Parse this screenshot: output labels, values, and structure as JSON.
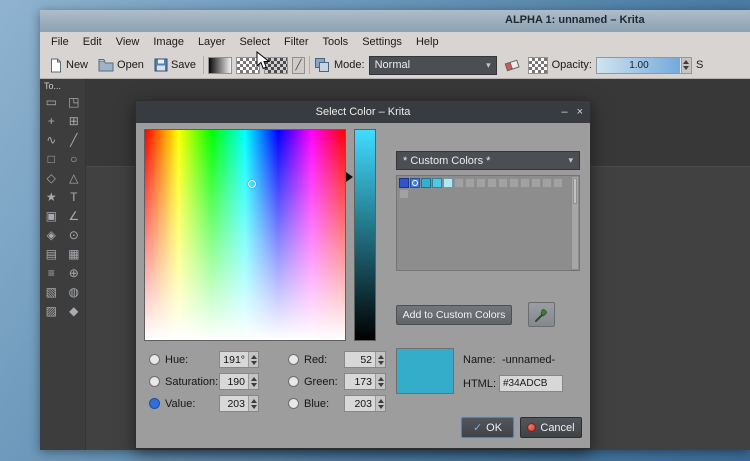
{
  "window": {
    "title": "ALPHA 1: unnamed – Krita",
    "menu": [
      "File",
      "Edit",
      "View",
      "Image",
      "Layer",
      "Select",
      "Filter",
      "Tools",
      "Settings",
      "Help"
    ],
    "toolbar": {
      "new": "New",
      "open": "Open",
      "save": "Save",
      "mode_label": "Mode:",
      "mode_value": "Normal",
      "combo_arrow": "▾",
      "opacity_label": "Opacity:",
      "opacity_value": "1.00",
      "size_label": "S"
    },
    "tool_dock": {
      "title": "To...",
      "tools": [
        {
          "name": "select-shapes",
          "glyph": "▭"
        },
        {
          "name": "select-outline",
          "glyph": "◳"
        },
        {
          "name": "move",
          "glyph": "+"
        },
        {
          "name": "transform",
          "glyph": "⊞"
        },
        {
          "name": "freehand-brush",
          "glyph": "∿"
        },
        {
          "name": "line",
          "glyph": "╱"
        },
        {
          "name": "rectangle",
          "glyph": "□"
        },
        {
          "name": "ellipse",
          "glyph": "○"
        },
        {
          "name": "polygon",
          "glyph": "◇"
        },
        {
          "name": "polyline",
          "glyph": "△"
        },
        {
          "name": "star",
          "glyph": "★"
        },
        {
          "name": "text",
          "glyph": "T"
        },
        {
          "name": "crop",
          "glyph": "▣"
        },
        {
          "name": "measure",
          "glyph": "∠"
        },
        {
          "name": "fill",
          "glyph": "◈"
        },
        {
          "name": "color-picker",
          "glyph": "⊙"
        },
        {
          "name": "gradient",
          "glyph": "▤"
        },
        {
          "name": "pattern",
          "glyph": "▦"
        },
        {
          "name": "pan",
          "glyph": "≡"
        },
        {
          "name": "zoom",
          "glyph": "⊕"
        },
        {
          "name": "select-rect",
          "glyph": "▧"
        },
        {
          "name": "select-ellipse",
          "glyph": "◍"
        },
        {
          "name": "select-polygonal",
          "glyph": "▨"
        },
        {
          "name": "select-similar",
          "glyph": "◆"
        }
      ]
    }
  },
  "dialog": {
    "title": "Select Color – Krita",
    "minimize_glyph": "–",
    "close_glyph": "×",
    "combo_value": "* Custom Colors *",
    "combo_arrow": "▾",
    "palette": {
      "swatches": [
        "#2f55cc",
        "#3f7ce0",
        "#38aecf",
        "#52c8e6",
        "#aee9f5"
      ],
      "selected_index": 1,
      "empty_count": 11
    },
    "add_button": "Add to Custom Colors",
    "fields": {
      "hue": {
        "label": "Hue:",
        "value": "191°",
        "selected": false
      },
      "saturation": {
        "label": "Saturation:",
        "value": "190",
        "selected": false
      },
      "value": {
        "label": "Value:",
        "value": "203",
        "selected": true
      },
      "red": {
        "label": "Red:",
        "value": "52",
        "selected": false
      },
      "green": {
        "label": "Green:",
        "value": "173",
        "selected": false
      },
      "blue": {
        "label": "Blue:",
        "value": "203",
        "selected": false
      }
    },
    "name_label": "Name:",
    "name_value": "-unnamed-",
    "html_label": "HTML:",
    "html_value": "#34ADCB",
    "current_color": "#34ADCB",
    "ok": "OK",
    "cancel": "Cancel"
  }
}
